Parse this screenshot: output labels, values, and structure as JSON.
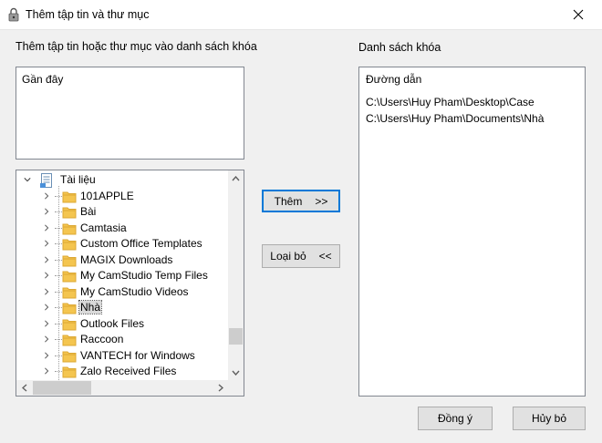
{
  "window": {
    "title": "Thêm tập tin và thư mục"
  },
  "left": {
    "label": "Thêm tập tin hoặc thư mục vào danh sách khóa",
    "recent_label": "Gần đây"
  },
  "tree": {
    "root_label": "Tài liệu",
    "items": [
      {
        "label": "101APPLE"
      },
      {
        "label": "Bài"
      },
      {
        "label": "Camtasia"
      },
      {
        "label": "Custom Office Templates"
      },
      {
        "label": "MAGIX Downloads"
      },
      {
        "label": "My CamStudio Temp Files"
      },
      {
        "label": "My CamStudio Videos"
      },
      {
        "label": "Nhà"
      },
      {
        "label": "Outlook Files"
      },
      {
        "label": "Raccoon"
      },
      {
        "label": "VANTECH for Windows"
      },
      {
        "label": "Zalo Received Files"
      }
    ],
    "selected_label": "Nhà"
  },
  "buttons": {
    "add_label": "Thêm",
    "add_arrows": ">>",
    "remove_label": "Loại bỏ",
    "remove_arrows": "<<",
    "ok_label": "Đồng ý",
    "cancel_label": "Hủy bỏ"
  },
  "right": {
    "label": "Danh sách khóa",
    "header": "Đường dẫn",
    "paths": [
      "C:\\Users\\Huy Pham\\Desktop\\Case",
      "C:\\Users\\Huy Pham\\Documents\\Nhà"
    ]
  },
  "colors": {
    "folder": "#f4c54f",
    "folder_dark": "#dca833",
    "accent": "#0078d7"
  }
}
